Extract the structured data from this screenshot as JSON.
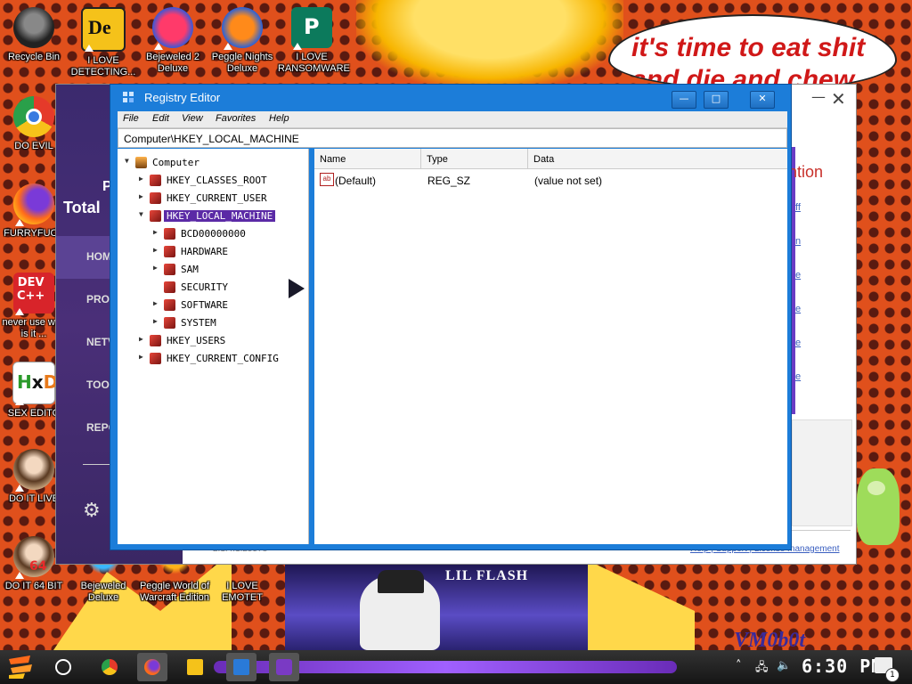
{
  "desktop": {
    "speech_text_1": "it's time to eat shit",
    "speech_text_2": "and die and chew",
    "album_title": "LIL FLASH",
    "vm_label": "VM0b0t",
    "icons": [
      {
        "label": "Recycle Bin",
        "icon": "recycle-bin-icon"
      },
      {
        "label": "I LOVE DETECTING...",
        "icon": "detect-it-easy-icon"
      },
      {
        "label": "Bejeweled 2 Deluxe",
        "icon": "bejeweled-2-icon"
      },
      {
        "label": "Peggle Nights Deluxe",
        "icon": "peggle-nights-icon"
      },
      {
        "label": "I LOVE RANSOMWARE",
        "icon": "publisher-icon"
      },
      {
        "label": "DO EVIL",
        "icon": "chrome-icon"
      },
      {
        "label": "FURRYFUCK",
        "icon": "firefox-icon"
      },
      {
        "label": "never use why is it ...",
        "icon": "dev-cpp-icon"
      },
      {
        "label": "SEX EDITO",
        "icon": "hxd-icon"
      },
      {
        "label": "DO IT LIVE",
        "icon": "portrait-icon"
      },
      {
        "label": "DO IT 64 BIT",
        "icon": "portrait-64-icon"
      },
      {
        "label": "Bejeweled Deluxe",
        "icon": "bejeweled-icon"
      },
      {
        "label": "Peggle World of Warcraft Edition",
        "icon": "peggle-wow-icon"
      },
      {
        "label": "I LOVE EMOTET",
        "icon": "emotet-icon"
      }
    ]
  },
  "background_window": {
    "brand_letter": "P",
    "brand_name": "Total",
    "nav": [
      "HOM",
      "PROT",
      "NETV",
      "TOOL",
      "REPO"
    ],
    "right_heading": "ntion",
    "links": [
      "ff",
      "n",
      "e",
      "e",
      "e",
      "e"
    ],
    "footer_left": "2.1.4.1.25578",
    "footer_right": "Help | Support | License management"
  },
  "regedit": {
    "title": "Registry Editor",
    "menu": [
      "File",
      "Edit",
      "View",
      "Favorites",
      "Help"
    ],
    "address": "Computer\\HKEY_LOCAL_MACHINE",
    "tree": [
      {
        "label": "Computer",
        "level": 0,
        "expanded": true,
        "selected": false
      },
      {
        "label": "HKEY_CLASSES_ROOT",
        "level": 1,
        "expanded": false,
        "selected": false
      },
      {
        "label": "HKEY_CURRENT_USER",
        "level": 1,
        "expanded": false,
        "selected": false
      },
      {
        "label": "HKEY_LOCAL_MACHINE",
        "level": 1,
        "expanded": true,
        "selected": true
      },
      {
        "label": "BCD00000000",
        "level": 2,
        "expanded": false,
        "selected": false
      },
      {
        "label": "HARDWARE",
        "level": 2,
        "expanded": false,
        "selected": false
      },
      {
        "label": "SAM",
        "level": 2,
        "expanded": false,
        "selected": false
      },
      {
        "label": "SECURITY",
        "level": 2,
        "expanded": false,
        "selected": false,
        "leaf": true
      },
      {
        "label": "SOFTWARE",
        "level": 2,
        "expanded": false,
        "selected": false
      },
      {
        "label": "SYSTEM",
        "level": 2,
        "expanded": false,
        "selected": false
      },
      {
        "label": "HKEY_USERS",
        "level": 1,
        "expanded": false,
        "selected": false
      },
      {
        "label": "HKEY_CURRENT_CONFIG",
        "level": 1,
        "expanded": false,
        "selected": false
      }
    ],
    "columns": [
      "Name",
      "Type",
      "Data"
    ],
    "rows": [
      {
        "name": "(Default)",
        "type": "REG_SZ",
        "data": "(value not set)"
      }
    ],
    "colors": {
      "title_bar": "#1c7dd9",
      "selection": "#5b2aa6"
    }
  },
  "taskbar": {
    "clock": "6:30 PM",
    "notification_count": "1",
    "apps": [
      "chrome-icon",
      "firefox-icon",
      "file-explorer-icon",
      "regedit-icon",
      "security-app-icon"
    ]
  }
}
